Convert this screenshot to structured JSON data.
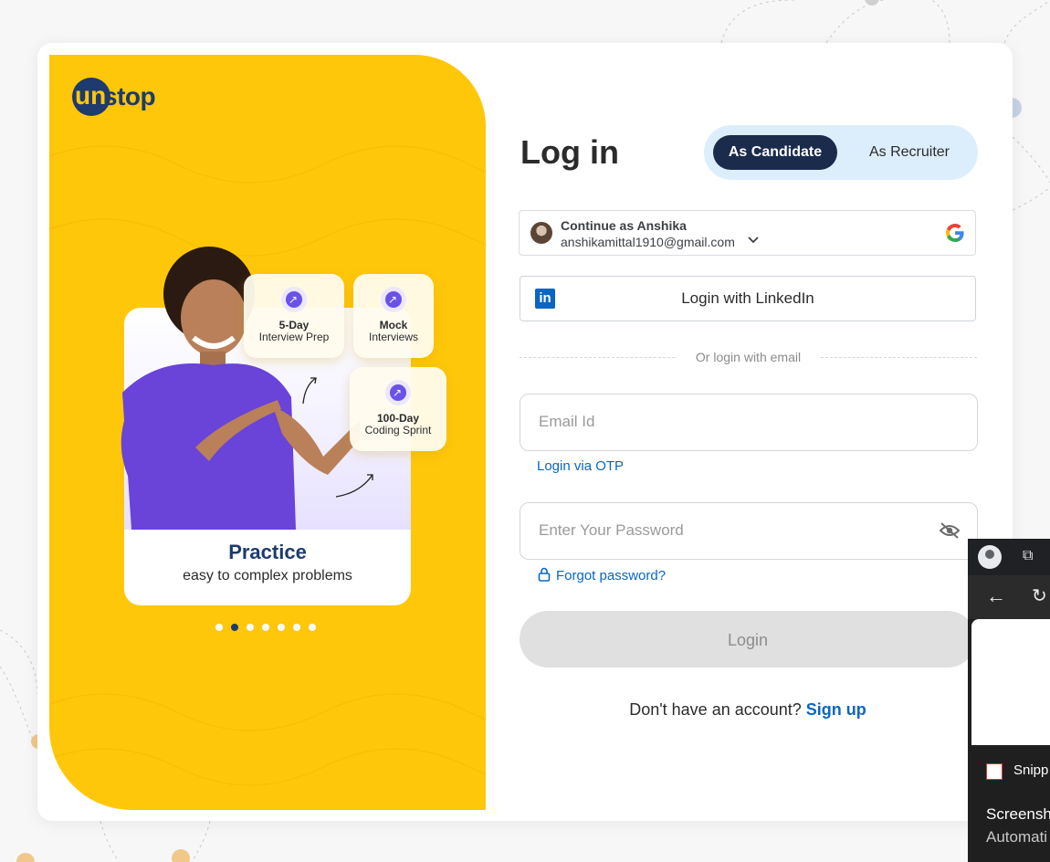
{
  "brand": {
    "logo_prefix": "un",
    "logo_suffix": "stop",
    "accent_yellow": "#ffc70a",
    "navy": "#1e3a6e"
  },
  "carousel": {
    "tiles": [
      {
        "line1": "5-Day",
        "line2": "Interview Prep",
        "icon": "trending-up-icon"
      },
      {
        "line1": "Mock",
        "line2": "Interviews",
        "icon": "trending-up-icon"
      },
      {
        "line1": "100-Day",
        "line2": "Coding Sprint",
        "icon": "trending-up-icon"
      }
    ],
    "title": "Practice",
    "subtitle": "easy to complex problems",
    "dot_count": 7,
    "active_dot": 2
  },
  "form": {
    "heading": "Log in",
    "role_toggle": {
      "selected": "As Candidate",
      "options": [
        "As Candidate",
        "As Recruiter"
      ]
    },
    "google": {
      "name": "Continue as Anshika",
      "email": "anshikamittal1910@gmail.com"
    },
    "linkedin_label": "Login with LinkedIn",
    "divider": "Or login with email",
    "email_placeholder": "Email Id",
    "otp_link": "Login via OTP",
    "password_placeholder": "Enter Your Password",
    "forgot_link": "Forgot password?",
    "login_button": "Login",
    "signup_prompt": "Don't have an account?",
    "signup_link": "Sign up"
  },
  "overlay_window": {
    "snip_label": "Snipp",
    "line1": "Screensh",
    "line2": "Automati"
  }
}
